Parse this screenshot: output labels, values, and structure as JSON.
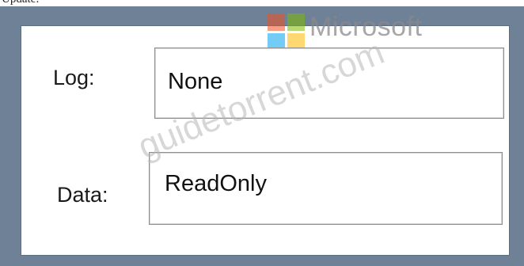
{
  "top_text": "Update:",
  "brand": {
    "name": "Microsoft",
    "logo_colors": [
      "#f25022",
      "#7fba00",
      "#00a4ef",
      "#ffb900"
    ]
  },
  "watermark": "guidetorrent.com",
  "fields": {
    "log": {
      "label": "Log:",
      "value": "None"
    },
    "data": {
      "label": "Data:",
      "value": "ReadOnly"
    }
  }
}
